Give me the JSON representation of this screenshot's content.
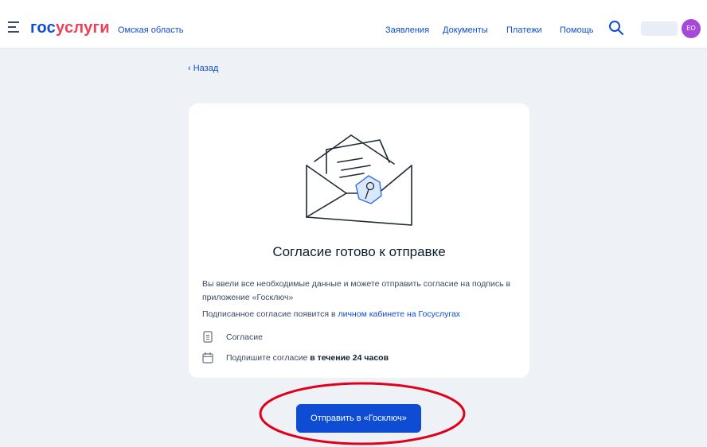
{
  "header": {
    "logo_part1": "гос",
    "logo_part2": "услуги",
    "region": "Омская область",
    "nav": [
      "Заявления",
      "Документы",
      "Платежи",
      "Помощь"
    ],
    "avatar_initials": "ЕО"
  },
  "back_link": "‹ Назад",
  "card": {
    "title": "Согласие готово к отправке",
    "description": "Вы ввели все необходимые данные и можете отправить согласие на подпись в приложение «Госключ»",
    "note_prefix": "Подписанное согласие появится в ",
    "note_link": "личном кабинете на Госуслугах",
    "document_label": "Согласие",
    "deadline_prefix": "Подпишите согласие ",
    "deadline_bold": "в течение 24 часов"
  },
  "submit_button": "Отправить в «Госключ»",
  "colors": {
    "brand_blue": "#0d4cd3",
    "brand_red": "#ee3f58",
    "avatar": "#a648d8",
    "annotation_red": "#e0001b"
  }
}
